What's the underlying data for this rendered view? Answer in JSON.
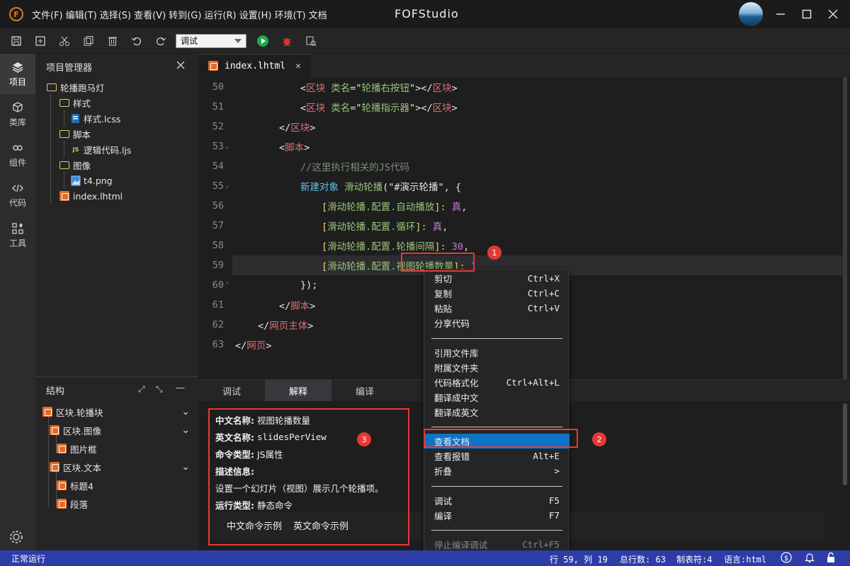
{
  "app": {
    "title": "FOFStudio",
    "logo_letter": "F"
  },
  "menu": [
    "文件(F)",
    "编辑(T)",
    "选择(S)",
    "查看(V)",
    "转到(G)",
    "运行(R)",
    "设置(H)",
    "环境(T)",
    "文档"
  ],
  "toolbar": {
    "mode": "调试"
  },
  "activity": [
    {
      "label": "项目",
      "icon": "layers-icon"
    },
    {
      "label": "类库",
      "icon": "cube-icon"
    },
    {
      "label": "组件",
      "icon": "link-icon"
    },
    {
      "label": "代码",
      "icon": "code-icon"
    },
    {
      "label": "工具",
      "icon": "tools-icon"
    }
  ],
  "explorer": {
    "title": "项目管理器",
    "items": [
      {
        "label": "轮播跑马灯",
        "type": "folder"
      },
      {
        "label": "样式",
        "type": "folder"
      },
      {
        "label": "样式.lcss",
        "type": "css"
      },
      {
        "label": "脚本",
        "type": "folder"
      },
      {
        "label": "逻辑代码.ljs",
        "type": "js",
        "badge": "JS"
      },
      {
        "label": "图像",
        "type": "folder"
      },
      {
        "label": "t4.png",
        "type": "image"
      },
      {
        "label": "index.lhtml",
        "type": "html"
      }
    ]
  },
  "structure": {
    "title": "结构",
    "items": [
      "区块.轮播块",
      "区块.图像",
      "图片框",
      "区块.文本",
      "标题4",
      "段落"
    ]
  },
  "editor": {
    "tab": "index.lhtml",
    "lines": [
      {
        "n": "50"
      },
      {
        "n": "51"
      },
      {
        "n": "52"
      },
      {
        "n": "53"
      },
      {
        "n": "54"
      },
      {
        "n": "55"
      },
      {
        "n": "56"
      },
      {
        "n": "57"
      },
      {
        "n": "58"
      },
      {
        "n": "59"
      },
      {
        "n": "60"
      },
      {
        "n": "61"
      },
      {
        "n": "62"
      },
      {
        "n": "63"
      }
    ],
    "code": {
      "l50": [
        "<",
        "区块",
        " 类名",
        "=\"",
        "轮播右按钮",
        "\"",
        "></",
        "区块",
        ">"
      ],
      "l51": [
        "<",
        "区块",
        " 类名",
        "=\"",
        "轮播指示器",
        "\"",
        "></",
        "区块",
        ">"
      ],
      "l52": [
        "</",
        "区块",
        ">"
      ],
      "l53": [
        "<",
        "脚本",
        ">"
      ],
      "l54": "//这里执行相关的JS代码",
      "l55": [
        "新建对象",
        " 滑动轮播",
        "(\"#演示轮播\", {"
      ],
      "l56": [
        "[",
        "滑动轮播.配置.自动播放",
        "]: ",
        "真",
        ","
      ],
      "l57": [
        "[",
        "滑动轮播.配置.循环",
        "]: ",
        "真",
        ","
      ],
      "l58": [
        "[",
        "滑动轮播.配置.轮播间隔",
        "]: ",
        "30",
        ","
      ],
      "l59": [
        "[",
        "滑动轮播.配置.",
        "视图轮播数量",
        "]: ",
        "1"
      ],
      "l60": "});",
      "l61": [
        "</",
        "脚本",
        ">"
      ],
      "l62": [
        "</",
        "网页主体",
        ">"
      ],
      "l63": [
        "</",
        "网页",
        ">"
      ]
    }
  },
  "bottom": {
    "tabs": [
      "调试",
      "解释",
      "编译"
    ],
    "doc": {
      "name_zh_label": "中文名称:",
      "name_zh": "视图轮播数量",
      "name_en_label": "英文名称:",
      "name_en": "slidesPerView",
      "cmd_type_label": "命令类型:",
      "cmd_type": "JS属性",
      "desc_label": "描述信息:",
      "desc": "设置一个幻灯片（视图）展示几个轮播项。",
      "run_type_label": "运行类型:",
      "run_type": "静态命令",
      "example_zh": "中文命令示例",
      "example_en": "英文命令示例"
    }
  },
  "context_menu": [
    {
      "label": "剪切",
      "shortcut": "Ctrl+X"
    },
    {
      "label": "复制",
      "shortcut": "Ctrl+C"
    },
    {
      "label": "粘贴",
      "shortcut": "Ctrl+V"
    },
    {
      "label": "分享代码",
      "shortcut": ""
    },
    {
      "label": "引用文件库",
      "shortcut": ""
    },
    {
      "label": "附属文件夹",
      "shortcut": ""
    },
    {
      "label": "代码格式化",
      "shortcut": "Ctrl+Alt+L"
    },
    {
      "label": "翻译成中文",
      "shortcut": ""
    },
    {
      "label": "翻译成英文",
      "shortcut": ""
    },
    {
      "label": "查看文档",
      "shortcut": ""
    },
    {
      "label": "查看报错",
      "shortcut": "Alt+E"
    },
    {
      "label": "折叠",
      "shortcut": ">"
    },
    {
      "label": "调试",
      "shortcut": "F5"
    },
    {
      "label": "编译",
      "shortcut": "F7"
    },
    {
      "label": "停止编译调试",
      "shortcut": "Ctrl+F5"
    }
  ],
  "annotations": [
    "1",
    "2",
    "3"
  ],
  "status": {
    "left": "正常运行",
    "position": "行 59, 列 19",
    "total": "总行数: 63",
    "tab": "制表符:4",
    "lang": "语言:html"
  },
  "colors": {
    "accent": "#0e74c7",
    "statusbar": "#2d3da8",
    "annotation": "#e53935"
  }
}
